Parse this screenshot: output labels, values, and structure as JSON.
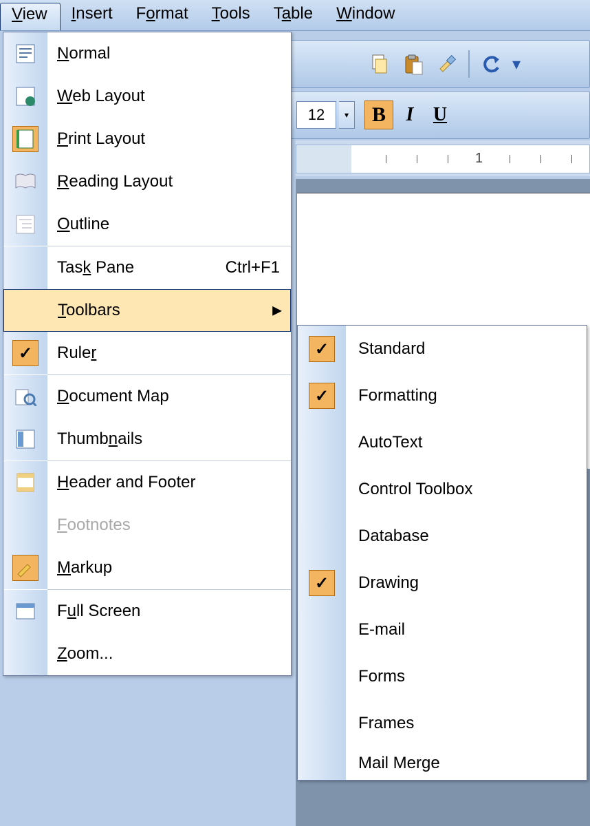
{
  "menubar": {
    "items": [
      {
        "key": "V",
        "rest": "iew",
        "active": true
      },
      {
        "key": "I",
        "rest": "nsert"
      },
      {
        "key": "",
        "rest": "F",
        "key2": "o",
        "rest2": "rmat"
      },
      {
        "key": "T",
        "rest": "ools"
      },
      {
        "key": "",
        "rest": "T",
        "key2": "a",
        "rest2": "ble"
      },
      {
        "key": "W",
        "rest": "indow"
      }
    ]
  },
  "view_menu": {
    "normal": "Normal",
    "normal_u": "N",
    "web": "Web Layout",
    "web_u": "W",
    "print": "Print Layout",
    "print_u": "P",
    "reading": "Reading Layout",
    "reading_u": "R",
    "outline": "Outline",
    "outline_u": "O",
    "task": "Task Pane",
    "task_u": "k",
    "task_sc": "Ctrl+F1",
    "toolbars": "Toolbars",
    "toolbars_u": "T",
    "ruler": "Ruler",
    "ruler_u": "R",
    "docmap": "Document Map",
    "docmap_u": "D",
    "thumbs": "Thumbnails",
    "thumbs_u": "n",
    "hf": "Header and Footer",
    "hf_u": "H",
    "foot": "Footnotes",
    "foot_u": "F",
    "markup": "Markup",
    "markup_u": "M",
    "full": "Full Screen",
    "full_u": "u",
    "zoom": "Zoom...",
    "zoom_u": "Z"
  },
  "toolbars_submenu": {
    "items": [
      {
        "label": "Standard",
        "checked": true
      },
      {
        "label": "Formatting",
        "checked": true
      },
      {
        "label": "AutoText",
        "checked": false
      },
      {
        "label": "Control Toolbox",
        "checked": false
      },
      {
        "label": "Database",
        "checked": false
      },
      {
        "label": "Drawing",
        "checked": true
      },
      {
        "label": "E-mail",
        "checked": false
      },
      {
        "label": "Forms",
        "checked": false
      },
      {
        "label": "Frames",
        "checked": false
      },
      {
        "label": "Mail Merge",
        "checked": false
      }
    ]
  },
  "format": {
    "size": "12",
    "bold": "B",
    "italic": "I",
    "underline": "U"
  },
  "ruler": {
    "num": "1"
  },
  "icons": {
    "check": "✓",
    "arrow": "▶",
    "drop": "▾"
  }
}
